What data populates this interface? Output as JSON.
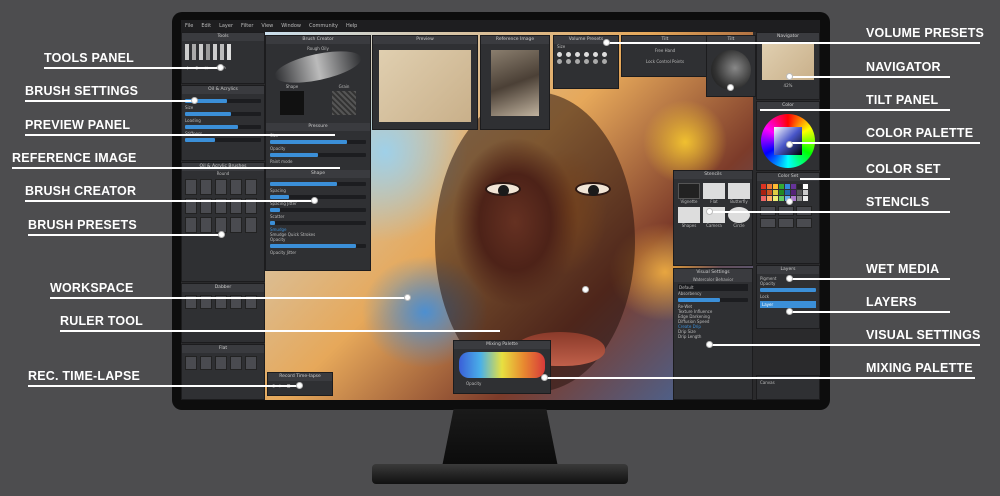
{
  "app": {
    "menus": [
      "File",
      "Edit",
      "Layer",
      "Filter",
      "View",
      "Window",
      "Community",
      "Help"
    ]
  },
  "panels": {
    "tools": "Tools",
    "brush_settings": "Oil & Acrylics",
    "brush_settings_rows": [
      "Size",
      "Loading",
      "Stiffness"
    ],
    "brush_presets": "Oil & Acrylic Brushes",
    "brush_presets_section": "Round",
    "dabber": "Dabber",
    "flat": "Flat",
    "brush_creator": "Brush Creator",
    "brush_creator_name": "Rough Oily",
    "brush_creator_shape": "Shape",
    "brush_creator_grain": "Grain",
    "pressure": "Pressure",
    "pressure_rows": [
      "Size",
      "Opacity"
    ],
    "paint_mode": "Paint mode",
    "shape_section": "Shape",
    "shape_rows": [
      "Spacing",
      "Spacing Jitter",
      "Scatter"
    ],
    "smudge": "Smudge",
    "smudge_quick": "Smudge Quick Strokes",
    "smudge_rows": [
      "Opacity",
      "Opacity Jitter"
    ],
    "preview": "Preview",
    "reference_image": "Reference Image",
    "volume_presets": "Volume Presets",
    "volume_size": "Size",
    "tilt": "Tilt",
    "tilt_options": [
      "Free Hand",
      "Lock Control Points"
    ],
    "navigator": "Navigator",
    "navigator_zoom": "42%",
    "color": "Color",
    "color_set": "Color Set",
    "stencils": "Stencils",
    "stencil_names": [
      "Vignette",
      "Flat",
      "Butterfly",
      "Shapes",
      "Camera",
      "Circle"
    ],
    "layers": "Layers",
    "layer_rows": [
      "Pigment",
      "Opacity",
      "Lock"
    ],
    "layer_name": "Layer",
    "canvas_layer": "Canvas",
    "visual_settings": "Visual Settings",
    "visual_section": "Watercolor Behavior",
    "visual_preset": "Default",
    "visual_rows": [
      "Absorbency",
      "Re-Wet",
      "Texture Influence",
      "Edge Darkening",
      "Diffusion Speed"
    ],
    "create_drip": "Create Drip",
    "drip_rows": [
      "Drip Size",
      "Drip Length"
    ],
    "mixing_palette": "Mixing Palette",
    "mixing_opacity": "Opacity",
    "record_timelapse": "Record Time-lapse"
  },
  "callouts_left": [
    "TOOLS PANEL",
    "BRUSH SETTINGS",
    "PREVIEW PANEL",
    "REFERENCE IMAGE",
    "BRUSH CREATOR",
    "BRUSH PRESETS",
    "WORKSPACE",
    "RULER TOOL",
    "REC. TIME-LAPSE"
  ],
  "callouts_right": [
    "VOLUME PRESETS",
    "NAVIGATOR",
    "TILT PANEL",
    "COLOR PALETTE",
    "COLOR SET",
    "STENCILS",
    "WET MEDIA",
    "LAYERS",
    "VISUAL SETTINGS",
    "MIXING PALETTE"
  ],
  "colors": {
    "accent": "#3b8fd8",
    "background": "#4d4d4f",
    "callout_text": "#ffffff"
  }
}
